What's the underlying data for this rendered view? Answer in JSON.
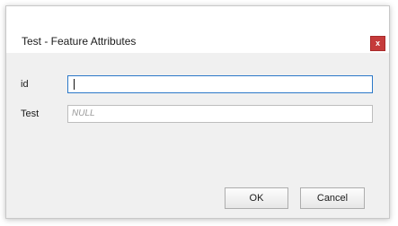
{
  "dialog": {
    "title": "Test - Feature Attributes",
    "close_label": "x"
  },
  "fields": [
    {
      "label": "id",
      "value": "",
      "focused": true
    },
    {
      "label": "Test",
      "placeholder": "NULL"
    }
  ],
  "buttons": {
    "ok_label": "OK",
    "cancel_label": "Cancel"
  },
  "colors": {
    "close_button": "#c53b3b",
    "focus_border": "#2b78c8",
    "dialog_background": "#f0f0f0"
  }
}
